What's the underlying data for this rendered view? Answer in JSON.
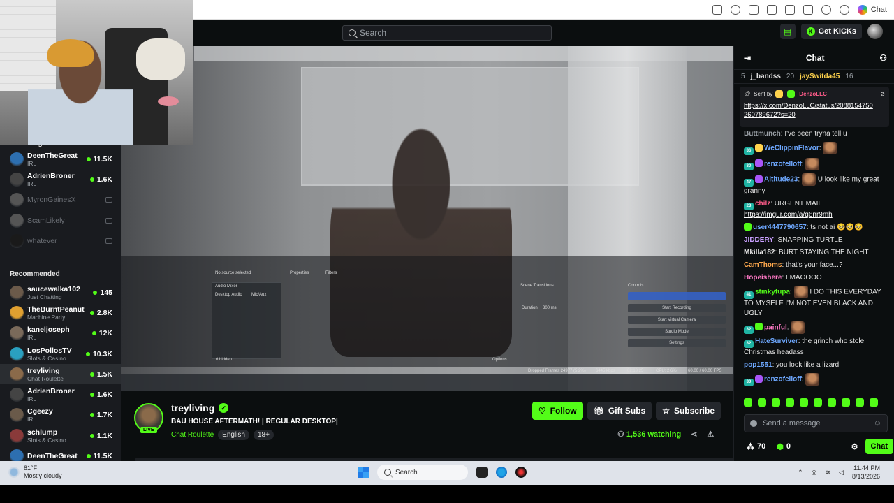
{
  "browser": {
    "chat_label": "Chat"
  },
  "topbar": {
    "search_placeholder": "Search",
    "get_kicks": "Get KICKs"
  },
  "sidebar": {
    "following_title": "Following",
    "following": [
      {
        "name": "DeenTheGreat",
        "category": "IRL",
        "viewers": "11.5K",
        "live": true,
        "color": "#2d6fb0"
      },
      {
        "name": "AdrienBroner",
        "category": "IRL",
        "viewers": "1.6K",
        "live": true,
        "color": "#444444"
      },
      {
        "name": "MyronGainesX",
        "category": "",
        "viewers": "",
        "live": false,
        "color": "#555555"
      },
      {
        "name": "ScamLikely",
        "category": "",
        "viewers": "",
        "live": false,
        "color": "#555555"
      },
      {
        "name": "whatever",
        "category": "",
        "viewers": "",
        "live": false,
        "color": "#1a1a1a"
      }
    ],
    "recommended_title": "Recommended",
    "recommended": [
      {
        "name": "saucewalka102",
        "category": "Just Chatting",
        "viewers": "145",
        "color": "#6b5a4a",
        "active": false
      },
      {
        "name": "TheBurntPeanut",
        "category": "Machine Party",
        "viewers": "2.8K",
        "color": "#e0a030",
        "active": false
      },
      {
        "name": "kaneljoseph",
        "category": "IRL",
        "viewers": "12K",
        "color": "#7a6a5a",
        "active": false
      },
      {
        "name": "LosPollosTV",
        "category": "Slots & Casino",
        "viewers": "10.3K",
        "color": "#2aa0c0",
        "active": false
      },
      {
        "name": "treyliving",
        "category": "Chat Roulette",
        "viewers": "1.5K",
        "color": "#8a6a4a",
        "active": true
      },
      {
        "name": "AdrienBroner",
        "category": "IRL",
        "viewers": "1.6K",
        "color": "#444444",
        "active": false
      },
      {
        "name": "Cgeezy",
        "category": "IRL",
        "viewers": "1.7K",
        "color": "#6a5a4a",
        "active": false
      },
      {
        "name": "schlump",
        "category": "Slots & Casino",
        "viewers": "1.1K",
        "color": "#8a3a3a",
        "active": false
      },
      {
        "name": "DeenTheGreat",
        "category": "",
        "viewers": "11.5K",
        "color": "#2d6fb0",
        "active": false
      }
    ]
  },
  "video": {
    "obs_labels": {
      "no_source": "No source selected",
      "properties": "Properties",
      "filters": "Filters",
      "audio_mixer": "Audio Mixer",
      "desktop_audio": "Desktop Audio",
      "mic_aux": "Mic/Aux",
      "scene_transitions": "Scene Transitions",
      "duration": "Duration",
      "duration_value": "300 ms",
      "controls": "Controls",
      "start_recording": "Start Recording",
      "start_virtual_camera": "Start Virtual Camera",
      "studio_mode": "Studio Mode",
      "settings": "Settings",
      "hidden": "6 hidden",
      "options": "Options",
      "dropped": "Dropped Frames 24977 (5.2%)",
      "kbps": "6445 kbps",
      "time": "02:13:25",
      "cpu": "CPU: 2.6%",
      "fps": "60.00 / 60.00 FPS"
    }
  },
  "stream": {
    "name": "treyliving",
    "live_badge": "LIVE",
    "title": "BAU HOUSE AFTERMATH! | REGULAR DESKTOP|",
    "category": "Chat Roulette",
    "tags": [
      "English",
      "18+"
    ],
    "follow": "Follow",
    "gift_subs": "Gift Subs",
    "subscribe": "Subscribe",
    "watching": "1,536 watching"
  },
  "chat": {
    "title": "Chat",
    "gifters": [
      {
        "rank": "5",
        "name": "",
        "count": ""
      },
      {
        "rank": "",
        "name": "j_bandss",
        "count": "20"
      },
      {
        "rank": "",
        "name": "jaySwitda45",
        "count": "16"
      }
    ],
    "pinned": {
      "sent_by": "Sent by",
      "user": "DenzoLLC",
      "link": "https://x.com/DenzoLLC/status/2088154750260789672?s=20"
    },
    "messages": [
      {
        "user": "Buttmunch",
        "color": "#9aa0a6",
        "text": "I've been tryna tell u",
        "badges": []
      },
      {
        "user": "WeClippinFlavor",
        "color": "#6ea8ff",
        "text": "",
        "emote": true,
        "badges": [
          "num",
          "yel"
        ],
        "num": "36"
      },
      {
        "user": "renzofelloff",
        "color": "#6ea8ff",
        "text": "",
        "emote": true,
        "badges": [
          "num",
          "gift"
        ],
        "num": "30"
      },
      {
        "user": "Altitude23",
        "color": "#6ea8ff",
        "text": "U look like my great granny",
        "emote": true,
        "badges": [
          "num",
          "gift"
        ],
        "num": "47"
      },
      {
        "user": "chilz",
        "color": "#ff5c8a",
        "text": "URGENT MAIL",
        "link": "https://imgur.com/a/q6nr9mh",
        "badges": [
          "num"
        ],
        "num": "23"
      },
      {
        "user": "user4447790657",
        "color": "#6ea8ff",
        "text": "ts not ai 🥺🥺🥺",
        "badges": [
          "gr"
        ]
      },
      {
        "user": "JIDDERY",
        "color": "#c9a0ff",
        "text": "SNAPPING TURTLE",
        "badges": []
      },
      {
        "user": "Mkilla182",
        "color": "#e5e5e5",
        "text": "BURT STAYING THE NIGHT",
        "badges": []
      },
      {
        "user": "CamThoms",
        "color": "#ffa94d",
        "text": "that's your face...?",
        "badges": []
      },
      {
        "user": "Hopeishere",
        "color": "#ff79c6",
        "text": "LMAOOOO",
        "badges": []
      },
      {
        "user": "stinkyfupa",
        "color": "#53fc18",
        "text": "I DO THIS EVERYDAY TO MYSELF I'M NOT EVEN BLACK AND UGLY",
        "emote": true,
        "badges": [
          "num"
        ],
        "num": "41"
      },
      {
        "user": "painful",
        "color": "#ff79c6",
        "text": "",
        "emote": true,
        "badges": [
          "num",
          "gr"
        ],
        "num": "32"
      },
      {
        "user": "HateSurviver",
        "color": "#6ea8ff",
        "text": "the grinch who stole Christmas headass",
        "badges": [
          "num"
        ],
        "num": "32"
      },
      {
        "user": "pop1551",
        "color": "#6ea8ff",
        "text": "you look like a lizard",
        "badges": []
      },
      {
        "user": "renzofelloff",
        "color": "#6ea8ff",
        "text": "",
        "emote": true,
        "badges": [
          "num",
          "gift"
        ],
        "num": "30"
      }
    ],
    "send_placeholder": "Send a message",
    "points": "70",
    "kicks": "0",
    "chat_button": "Chat"
  },
  "taskbar": {
    "temp": "81°F",
    "weather": "Mostly cloudy",
    "search": "Search",
    "time": "11:44 PM",
    "date": "8/13/2026"
  },
  "colors": {
    "accent": "#53fc18",
    "bg": "#0b0e0f",
    "panel": "#191b1f"
  }
}
